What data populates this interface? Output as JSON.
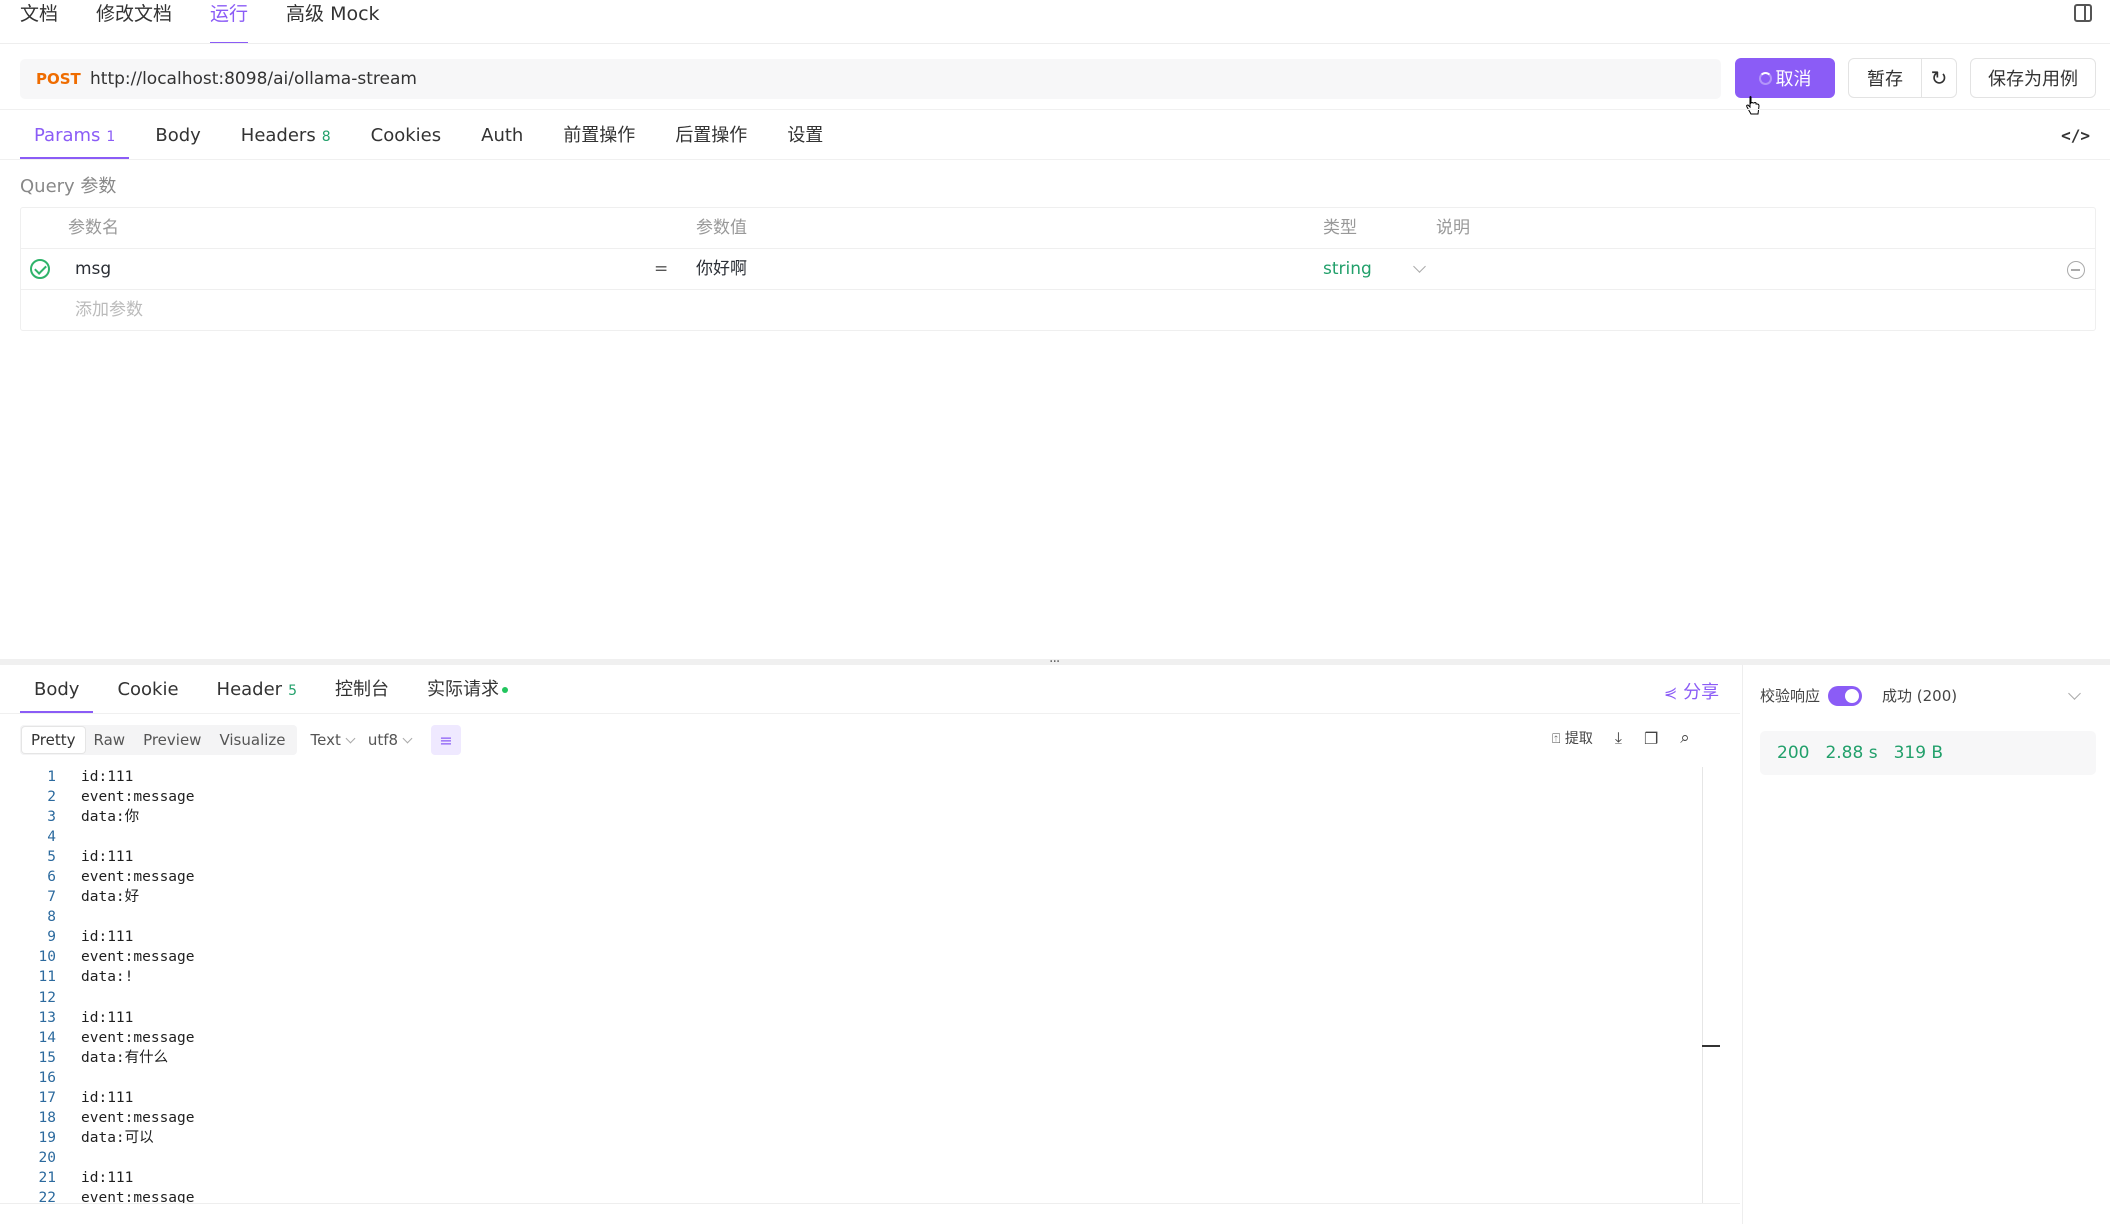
{
  "top_tabs": [
    {
      "label": "文档"
    },
    {
      "label": "修改文档"
    },
    {
      "label": "运行"
    },
    {
      "label": "高级 Mock"
    }
  ],
  "request": {
    "method": "POST",
    "url": "http://localhost:8098/ai/ollama-stream"
  },
  "actions": {
    "cancel": "取消",
    "save_temp": "暂存",
    "reset_icon": "↻",
    "save_case": "保存为用例"
  },
  "request_tabs": [
    {
      "label": "Params",
      "badge": "1"
    },
    {
      "label": "Body",
      "badge": ""
    },
    {
      "label": "Headers",
      "badge": "8"
    },
    {
      "label": "Cookies",
      "badge": ""
    },
    {
      "label": "Auth",
      "badge": ""
    },
    {
      "label": "前置操作",
      "badge": ""
    },
    {
      "label": "后置操作",
      "badge": ""
    },
    {
      "label": "设置",
      "badge": ""
    }
  ],
  "code_toggle": "</>",
  "query": {
    "section_label": "Query 参数",
    "headers": {
      "name": "参数名",
      "value": "参数值",
      "type": "类型",
      "desc": "说明"
    },
    "rows": [
      {
        "name": "msg",
        "eq": "=",
        "value": "你好啊",
        "type": "string",
        "desc": ""
      }
    ],
    "add_placeholder": "添加参数"
  },
  "splitter_grip": "···",
  "response_tabs": [
    {
      "label": "Body",
      "badge": ""
    },
    {
      "label": "Cookie",
      "badge": ""
    },
    {
      "label": "Header",
      "badge": "5"
    },
    {
      "label": "控制台",
      "badge": ""
    },
    {
      "label": "实际请求",
      "badge": ""
    }
  ],
  "share": "分享",
  "format": {
    "modes": [
      "Pretty",
      "Raw",
      "Preview",
      "Visualize"
    ],
    "type": "Text",
    "encoding": "utf8",
    "extract": "提取"
  },
  "code_lines": [
    "id:111",
    "event:message",
    "data:你",
    "",
    "id:111",
    "event:message",
    "data:好",
    "",
    "id:111",
    "event:message",
    "data:!",
    "",
    "id:111",
    "event:message",
    "data:有什么",
    "",
    "id:111",
    "event:message",
    "data:可以",
    "",
    "id:111",
    "event:message"
  ],
  "verify": {
    "label": "校验响应",
    "enabled": true,
    "result": "成功 (200)"
  },
  "stats": {
    "status": "200",
    "time": "2.88 s",
    "size": "319 B"
  },
  "colors": {
    "accent": "#8b5cf6",
    "method": "#ef6c00",
    "success": "#22a06b"
  }
}
